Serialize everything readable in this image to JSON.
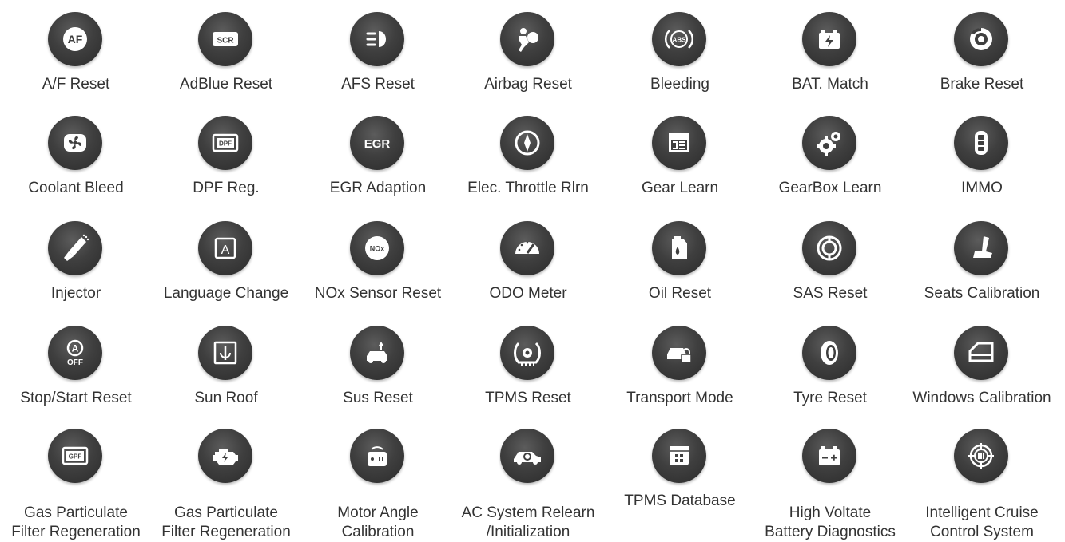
{
  "colors": {
    "icon_background": "#3f3f3f",
    "icon_glyph": "#ffffff",
    "label_text": "#333333",
    "page_background": "#ffffff"
  },
  "functions": [
    {
      "id": "af-reset",
      "label": "A/F Reset",
      "icon": "af-icon",
      "icon_text": "AF"
    },
    {
      "id": "adblue-reset",
      "label": "AdBlue Reset",
      "icon": "scr-icon",
      "icon_text": "SCR"
    },
    {
      "id": "afs-reset",
      "label": "AFS Reset",
      "icon": "headlight-icon"
    },
    {
      "id": "airbag-reset",
      "label": "Airbag Reset",
      "icon": "airbag-icon"
    },
    {
      "id": "bleeding",
      "label": "Bleeding",
      "icon": "abs-icon",
      "icon_text": "ABS"
    },
    {
      "id": "bat-match",
      "label": "BAT. Match",
      "icon": "battery-icon"
    },
    {
      "id": "brake-reset",
      "label": "Brake Reset",
      "icon": "brake-disc-icon"
    },
    {
      "id": "coolant-bleed",
      "label": "Coolant Bleed",
      "icon": "fan-icon"
    },
    {
      "id": "dpf-reg",
      "label": "DPF Reg.",
      "icon": "dpf-icon",
      "icon_text": "DPF"
    },
    {
      "id": "egr-adaption",
      "label": "EGR Adaption",
      "icon": "egr-icon",
      "icon_text": "EGR"
    },
    {
      "id": "elec-throttle",
      "label": "Elec. Throttle Rlrn",
      "icon": "throttle-icon"
    },
    {
      "id": "gear-learn",
      "label": "Gear Learn",
      "icon": "gear-window-icon"
    },
    {
      "id": "gearbox-learn",
      "label": "GearBox Learn",
      "icon": "gears-icon"
    },
    {
      "id": "immo",
      "label": "IMMO",
      "icon": "key-fob-icon"
    },
    {
      "id": "injector",
      "label": "Injector",
      "icon": "injector-icon"
    },
    {
      "id": "language-change",
      "label": "Language Change",
      "icon": "language-icon",
      "icon_text": "A"
    },
    {
      "id": "nox-sensor-reset",
      "label": "NOx Sensor Reset",
      "icon": "nox-icon",
      "icon_text": "NOx"
    },
    {
      "id": "odo-meter",
      "label": "ODO Meter",
      "icon": "speedometer-icon"
    },
    {
      "id": "oil-reset",
      "label": "Oil Reset",
      "icon": "oil-can-icon"
    },
    {
      "id": "sas-reset",
      "label": "SAS Reset",
      "icon": "steering-wheel-icon"
    },
    {
      "id": "seats-calibration",
      "label": "Seats Calibration",
      "icon": "seat-icon"
    },
    {
      "id": "stop-start-reset",
      "label": "Stop/Start Reset",
      "icon": "auto-off-icon",
      "icon_text": "A",
      "icon_text2": "OFF"
    },
    {
      "id": "sun-roof",
      "label": "Sun Roof",
      "icon": "sunroof-icon"
    },
    {
      "id": "sus-reset",
      "label": "Sus Reset",
      "icon": "suspension-icon"
    },
    {
      "id": "tpms-reset",
      "label": "TPMS Reset",
      "icon": "tpms-icon"
    },
    {
      "id": "transport-mode",
      "label": "Transport Mode",
      "icon": "car-lock-icon"
    },
    {
      "id": "tyre-reset",
      "label": "Tyre Reset",
      "icon": "tyre-icon"
    },
    {
      "id": "windows-calibration",
      "label": "Windows Calibration",
      "icon": "car-window-icon"
    },
    {
      "id": "gpf-regeneration",
      "label_lines": [
        "Gas Particulate",
        "Filter Regeneration"
      ],
      "icon": "gpf-icon",
      "icon_text": "GPF"
    },
    {
      "id": "gas-particulate-engine",
      "label_lines": [
        "Gas Particulate",
        "Filter Regeneration"
      ],
      "icon": "engine-icon"
    },
    {
      "id": "motor-angle",
      "label_lines": [
        "Motor Angle",
        "Calibration"
      ],
      "icon": "motor-icon"
    },
    {
      "id": "ac-system-relearn",
      "label_lines": [
        "AC System Relearn",
        "/Initialization"
      ],
      "icon": "ac-car-icon"
    },
    {
      "id": "tpms-database",
      "label": "TPMS Database",
      "icon": "database-icon"
    },
    {
      "id": "high-voltage-battery",
      "label_lines": [
        "High Voltate",
        "Battery Diagnostics"
      ],
      "icon": "hv-battery-icon"
    },
    {
      "id": "intelligent-cruise",
      "label_lines": [
        "Intelligent Cruise",
        "Control System"
      ],
      "icon": "cruise-target-icon"
    }
  ]
}
